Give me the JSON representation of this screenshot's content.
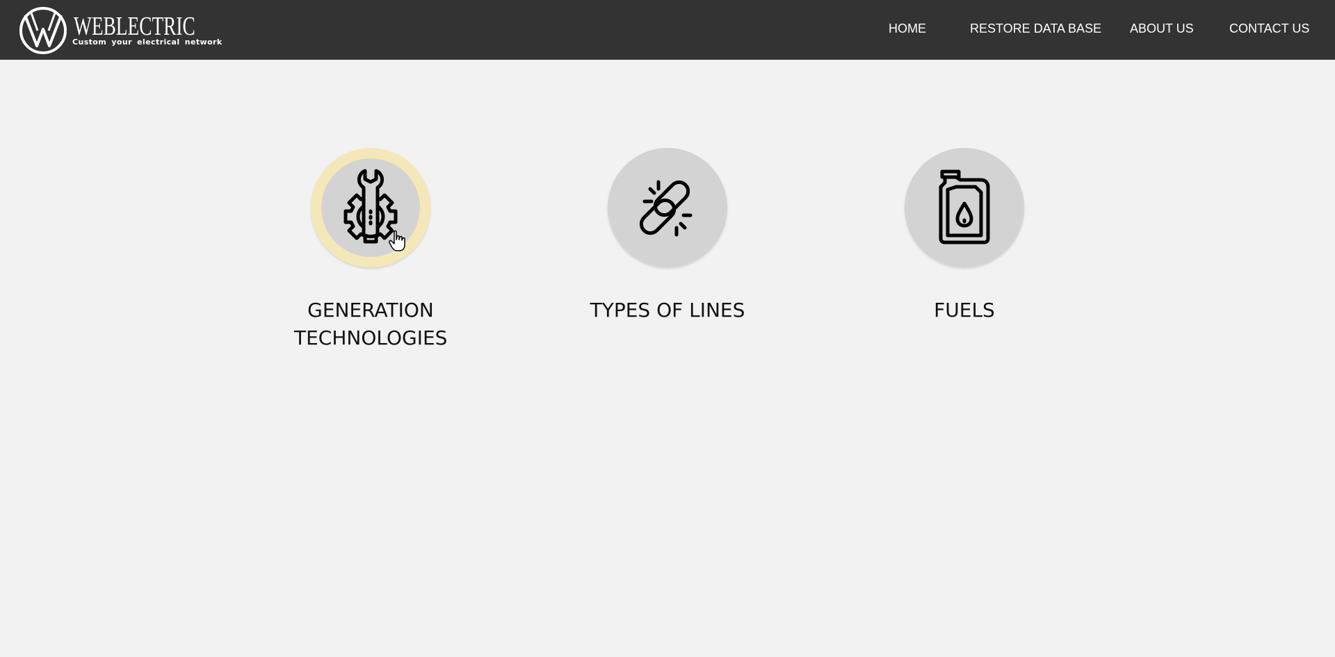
{
  "header": {
    "logo": {
      "name": "WEBLECTRIC",
      "tagline": "Custom your electrical network",
      "icon": "weblectric-logo-icon"
    },
    "nav": [
      {
        "label": "HOME"
      },
      {
        "label": "RESTORE DATA BASE"
      },
      {
        "label": "ABOUT US"
      },
      {
        "label": "CONTACT US"
      }
    ]
  },
  "main": {
    "cards": [
      {
        "label": "GENERATION TECHNOLOGIES",
        "icon": "wrench-gear-icon",
        "hovered": true
      },
      {
        "label": "TYPES OF LINES",
        "icon": "broken-chain-link-icon",
        "hovered": false
      },
      {
        "label": "FUELS",
        "icon": "fuel-can-icon",
        "hovered": false
      }
    ]
  },
  "colors": {
    "header_bg": "#333333",
    "page_bg": "#f2f2f2",
    "circle_bg": "#d3d3d3",
    "hover_ring": "#f5e8b8"
  }
}
